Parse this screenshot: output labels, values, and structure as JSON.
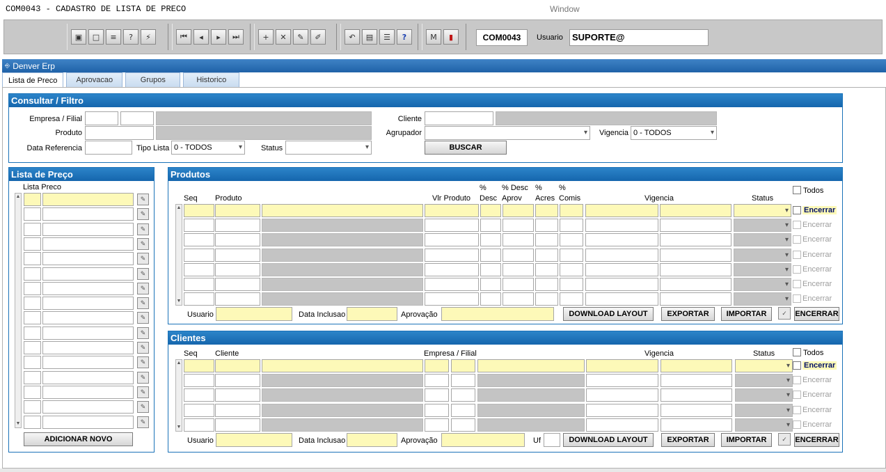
{
  "app_title": "COM0043 - CADASTRO DE LISTA DE PRECO",
  "window_label": "Window",
  "program_code": "COM0043",
  "user_label": "Usuario",
  "user_value": "SUPORTE@",
  "app_name": "Denver Erp",
  "tabs": [
    {
      "label": "Lista de Preco",
      "active": true
    },
    {
      "label": "Aprovacao"
    },
    {
      "label": "Grupos"
    },
    {
      "label": "Historico"
    }
  ],
  "filter": {
    "title": "Consultar / Filtro",
    "empresa_label": "Empresa / Filial",
    "produto_label": "Produto",
    "data_ref_label": "Data Referencia",
    "tipo_lista_label": "Tipo Lista",
    "tipo_lista_value": "0 - TODOS",
    "status_label": "Status",
    "cliente_label": "Cliente",
    "agrupador_label": "Agrupador",
    "vigencia_label": "Vigencia",
    "vigencia_value": "0 - TODOS",
    "search_label": "BUSCAR"
  },
  "lista": {
    "title": "Lista de Preço",
    "column_label": "Lista Preco",
    "add_label": "ADICIONAR NOVO"
  },
  "produtos": {
    "title": "Produtos",
    "headers": {
      "seq": "Seq",
      "produto": "Produto",
      "vlr": "Vlr Produto",
      "desc_pct": "%",
      "desc": "Desc",
      "desc_aprov_pct": "% Desc",
      "aprov": "Aprov",
      "acres_pct": "%",
      "acres": "Acres",
      "comis_pct": "%",
      "comis": "Comis",
      "vigencia": "Vigencia",
      "status": "Status",
      "todos": "Todos"
    },
    "encerrar": "Encerrar",
    "usuario_label": "Usuario",
    "data_inclusao_label": "Data Inclusao",
    "aprovacao_label": "Aprovação",
    "buttons": {
      "download": "DOWNLOAD LAYOUT",
      "export": "EXPORTAR",
      "import": "IMPORTAR",
      "close": "ENCERRAR"
    }
  },
  "clientes": {
    "title": "Clientes",
    "headers": {
      "seq": "Seq",
      "cliente": "Cliente",
      "empresa": "Empresa / Filial",
      "vigencia": "Vigencia",
      "status": "Status",
      "todos": "Todos"
    },
    "encerrar": "Encerrar",
    "usuario_label": "Usuario",
    "data_inclusao_label": "Data Inclusao",
    "aprovacao_label": "Aprovação",
    "uf_label": "Uf",
    "buttons": {
      "download": "DOWNLOAD LAYOUT",
      "export": "EXPORTAR",
      "import": "IMPORTAR",
      "close": "ENCERRAR"
    }
  },
  "toolbar_icons": [
    "save-icon",
    "window-icon",
    "print-icon",
    "query-icon",
    "execute-icon",
    "first-record-icon",
    "prev-record-icon",
    "next-record-icon",
    "last-record-icon",
    "insert-icon",
    "delete-icon",
    "edit-icon",
    "clear-icon",
    "undo-icon",
    "clipboard-icon",
    "list-icon",
    "help-icon",
    "menu-icon",
    "exit-icon"
  ]
}
